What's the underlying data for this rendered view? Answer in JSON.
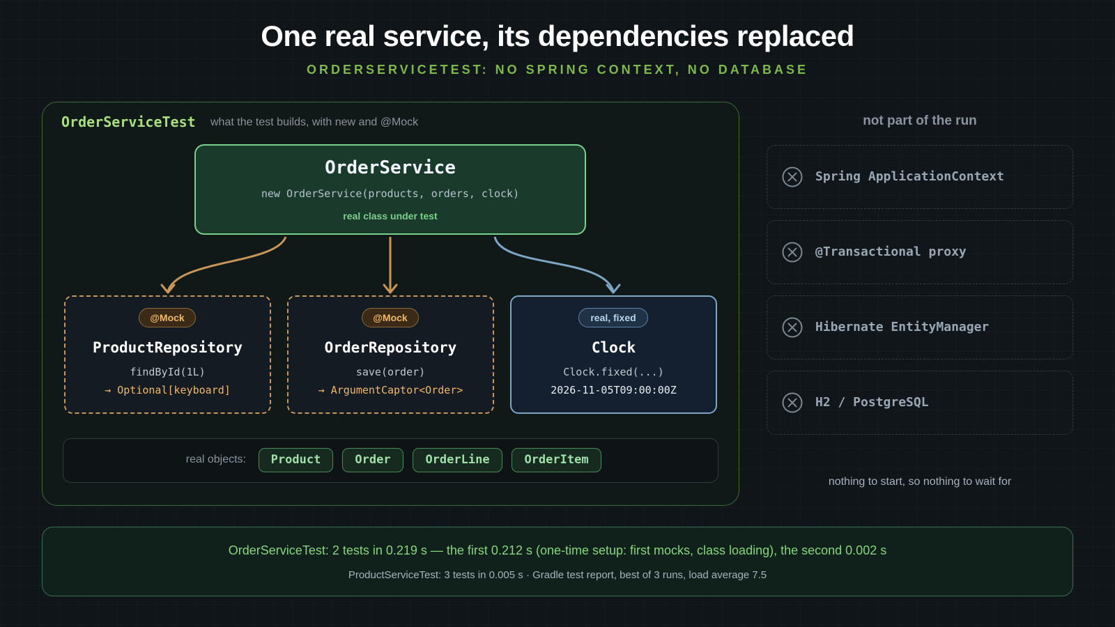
{
  "header": {
    "title": "One real service, its dependencies replaced",
    "subtitle": "ORDERSERVICETEST: NO SPRING CONTEXT, NO DATABASE"
  },
  "panel": {
    "heading": "OrderServiceTest",
    "caption": "what the test builds, with new and @Mock"
  },
  "service": {
    "name": "OrderService",
    "constructor": "new OrderService(products, orders, clock)",
    "note": "real class under test"
  },
  "dependencies": [
    {
      "badge": "@Mock",
      "name": "ProductRepository",
      "call": "findById(1L)",
      "result": "→ Optional[keyboard]",
      "kind": "mock"
    },
    {
      "badge": "@Mock",
      "name": "OrderRepository",
      "call": "save(order)",
      "result": "→ ArgumentCaptor<Order>",
      "kind": "mock"
    },
    {
      "badge": "real, fixed",
      "name": "Clock",
      "call": "Clock.fixed(...)",
      "result": "2026-11-05T09:00:00Z",
      "kind": "real"
    }
  ],
  "real_objects": {
    "label": "real objects:",
    "items": [
      "Product",
      "Order",
      "OrderLine",
      "OrderItem"
    ]
  },
  "side": {
    "heading": "not part of the run",
    "items": [
      "Spring ApplicationContext",
      "@Transactional proxy",
      "Hibernate EntityManager",
      "H2 / PostgreSQL"
    ],
    "icon": "x-circle-icon",
    "footnote": "nothing to start, so nothing to wait for"
  },
  "summary": {
    "main": "OrderServiceTest: 2 tests in 0.219 s — the first 0.212 s (one-time setup: first mocks, class loading), the second 0.002 s",
    "sub": "ProductServiceTest: 3 tests in 0.005 s · Gradle test report, best of 3 runs, load average 7.5"
  },
  "colors": {
    "accent_green": "#7bd08a",
    "mock_orange": "#c9965a",
    "real_blue": "#7fa6c6"
  }
}
